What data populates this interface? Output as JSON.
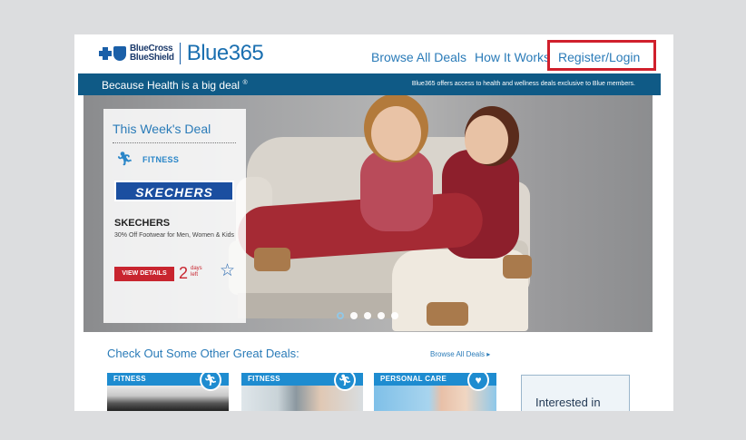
{
  "header": {
    "brand": {
      "line1": "BlueCross",
      "line2": "BlueShield",
      "product": "Blue365"
    },
    "nav": {
      "browse_all_deals": "Browse All Deals",
      "how_it_works": "How It Works",
      "register_login": "Register/Login"
    },
    "highlight_color": "#d0202c"
  },
  "banner": {
    "tagline": "Because Health is a big deal",
    "tagline_mark": "®",
    "description": "Blue365 offers access to health and wellness deals exclusive to Blue members.",
    "color": "#0f5a86"
  },
  "hero": {
    "deal": {
      "heading": "This Week's Deal",
      "category": "FITNESS",
      "category_icon": "runner-icon",
      "brand_logo_text": "SKECHERS",
      "brand_name": "SKECHERS",
      "description": "30% Off Footwear for Men, Women & Kids",
      "view_details": "VIEW DETAILS",
      "days_count": "2",
      "days_label_1": "days",
      "days_label_2": "left",
      "favorite_icon": "star-icon"
    },
    "carousel": {
      "slide_count": 5,
      "active_index": 0
    }
  },
  "deals_section": {
    "title": "Check Out Some Other Great Deals:",
    "browse_link": "Browse All Deals",
    "browse_arrow": "▸",
    "tiles": [
      {
        "category": "FITNESS",
        "icon": "runner-icon"
      },
      {
        "category": "FITNESS",
        "icon": "runner-icon"
      },
      {
        "category": "PERSONAL CARE",
        "icon": "heart-icon"
      }
    ],
    "interest_box_text": "Interested in"
  },
  "colors": {
    "accent": "#2a7bb8",
    "tile_bar": "#1e8cd0",
    "cta": "#c8252f"
  }
}
